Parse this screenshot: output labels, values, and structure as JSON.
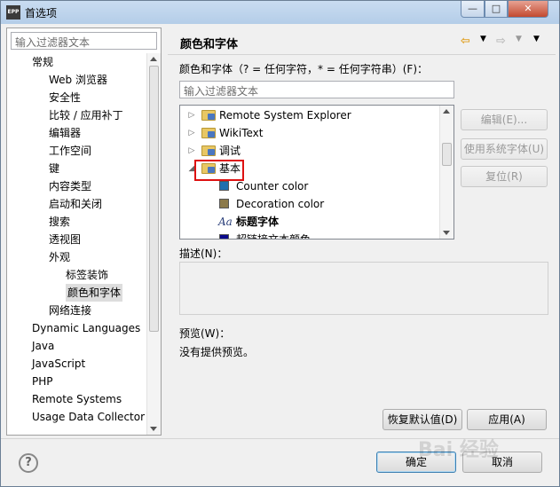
{
  "window": {
    "app_icon_text": "EPP",
    "title": "首选项",
    "controls": {
      "minimize": "—",
      "maximize": "□",
      "close": "✕"
    }
  },
  "left": {
    "filter_placeholder": "输入过滤器文本",
    "nav_items": [
      {
        "label": "常规",
        "level": 1
      },
      {
        "label": "Web 浏览器",
        "level": 2
      },
      {
        "label": "安全性",
        "level": 2
      },
      {
        "label": "比较 / 应用补丁",
        "level": 2
      },
      {
        "label": "编辑器",
        "level": 2
      },
      {
        "label": "工作空间",
        "level": 2
      },
      {
        "label": "键",
        "level": 2
      },
      {
        "label": "内容类型",
        "level": 2
      },
      {
        "label": "启动和关闭",
        "level": 2
      },
      {
        "label": "搜索",
        "level": 2
      },
      {
        "label": "透视图",
        "level": 2
      },
      {
        "label": "外观",
        "level": 2
      },
      {
        "label": "标签装饰",
        "level": 3
      },
      {
        "label": "颜色和字体",
        "level": 3,
        "selected": true
      },
      {
        "label": "网络连接",
        "level": 2
      },
      {
        "label": "Dynamic Languages",
        "level": 1
      },
      {
        "label": "Java",
        "level": 1
      },
      {
        "label": "JavaScript",
        "level": 1
      },
      {
        "label": "PHP",
        "level": 1
      },
      {
        "label": "Remote Systems",
        "level": 1
      },
      {
        "label": "Usage Data Collector",
        "level": 1
      }
    ]
  },
  "right": {
    "title": "颜色和字体",
    "nav_icons": [
      "back-arrow-icon",
      "forward-arrow-icon",
      "view-menu-icon"
    ],
    "colors_fonts_label": "颜色和字体（? = 任何字符，* = 任何字符串）(F)：",
    "filter_placeholder": "输入过滤器文本",
    "tree": [
      {
        "label": "Remote System Explorer",
        "kind": "folder",
        "twisty": "▷"
      },
      {
        "label": "WikiText",
        "kind": "folder",
        "twisty": "▷"
      },
      {
        "label": "调试",
        "kind": "folder",
        "twisty": "▷"
      },
      {
        "label": "基本",
        "kind": "folder",
        "twisty": "◢",
        "highlighted": true
      },
      {
        "label": "Counter color",
        "kind": "color",
        "color": "#1f6fae"
      },
      {
        "label": "Decoration color",
        "kind": "color",
        "color": "#8c7a4a"
      },
      {
        "label": "标题字体",
        "kind": "font",
        "icon_text": "Aa"
      },
      {
        "label": "超链接文本颜色",
        "kind": "color",
        "color": "#0a0a8c"
      }
    ],
    "buttons": {
      "edit": "编辑(E)...",
      "use_system_font": "使用系统字体(U)",
      "reset": "复位(R)"
    },
    "description_label": "描述(N)：",
    "preview_label": "预览(W)：",
    "preview_text": "没有提供预览。",
    "restore_defaults": "恢复默认值(D)",
    "apply": "应用(A)"
  },
  "footer": {
    "help": "?",
    "ok": "确定",
    "cancel": "取消"
  },
  "watermark": "Bai 经验"
}
